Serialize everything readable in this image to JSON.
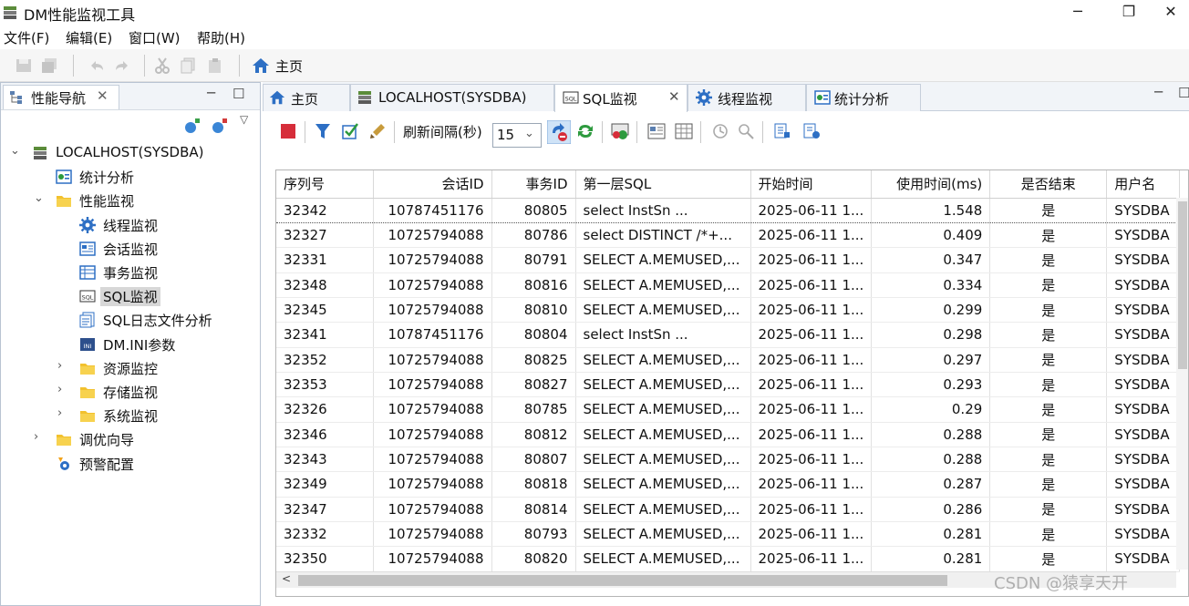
{
  "window": {
    "title": "DM性能监视工具",
    "controls": [
      "─",
      "❐",
      "✕"
    ]
  },
  "menu": [
    "文件(F)",
    "编辑(E)",
    "窗口(W)",
    "帮助(H)"
  ],
  "toolbar": {
    "home_label": "主页"
  },
  "nav": {
    "title": "性能导航",
    "tree": [
      {
        "label": "LOCALHOST(SYSDBA)",
        "icon": "server-icon",
        "level": 0,
        "expanded": true
      },
      {
        "label": "统计分析",
        "icon": "stats-icon",
        "level": 1
      },
      {
        "label": "性能监视",
        "icon": "folder-icon",
        "level": 1,
        "expanded": true
      },
      {
        "label": "线程监视",
        "icon": "gear-icon",
        "level": 2
      },
      {
        "label": "会话监视",
        "icon": "session-icon",
        "level": 2
      },
      {
        "label": "事务监视",
        "icon": "transaction-icon",
        "level": 2
      },
      {
        "label": "SQL监视",
        "icon": "sql-icon",
        "level": 2,
        "selected": true
      },
      {
        "label": "SQL日志文件分析",
        "icon": "log-icon",
        "level": 2
      },
      {
        "label": "DM.INI参数",
        "icon": "ini-icon",
        "level": 2
      },
      {
        "label": "资源监控",
        "icon": "folder-icon",
        "level": 2,
        "collapsed": true
      },
      {
        "label": "存储监视",
        "icon": "folder-icon",
        "level": 2,
        "collapsed": true
      },
      {
        "label": "系统监视",
        "icon": "folder-icon",
        "level": 2,
        "collapsed": true
      },
      {
        "label": "调优向导",
        "icon": "folder-icon",
        "level": 1,
        "collapsed": true
      },
      {
        "label": "预警配置",
        "icon": "alert-config-icon",
        "level": 1
      }
    ]
  },
  "tabs": [
    {
      "label": "主页",
      "icon": "home-icon"
    },
    {
      "label": "LOCALHOST(SYSDBA)",
      "icon": "server-icon"
    },
    {
      "label": "SQL监视",
      "icon": "sql-icon",
      "active": true,
      "closable": true
    },
    {
      "label": "线程监视",
      "icon": "gear-icon"
    },
    {
      "label": "统计分析",
      "icon": "stats-icon"
    }
  ],
  "sql_toolbar": {
    "interval_label": "刷新间隔(秒)",
    "interval_value": "15"
  },
  "table": {
    "columns": [
      "序列号",
      "会话ID",
      "事务ID",
      "第一层SQL",
      "开始时间",
      "使用时间(ms)",
      "是否结束",
      "用户名"
    ],
    "rows": [
      [
        "32342",
        "10787451176",
        "80805",
        "select            InstSn ...",
        "2025-06-11 1...",
        "1.548",
        "是",
        "SYSDBA"
      ],
      [
        "32327",
        "10725794088",
        "80786",
        "select DISTINCT  /*+...",
        "2025-06-11 1...",
        "0.409",
        "是",
        "SYSDBA"
      ],
      [
        "32331",
        "10725794088",
        "80791",
        "SELECT A.MEMUSED,...",
        "2025-06-11 1...",
        "0.347",
        "是",
        "SYSDBA"
      ],
      [
        "32348",
        "10725794088",
        "80816",
        "SELECT A.MEMUSED,...",
        "2025-06-11 1...",
        "0.334",
        "是",
        "SYSDBA"
      ],
      [
        "32345",
        "10725794088",
        "80810",
        "SELECT A.MEMUSED,...",
        "2025-06-11 1...",
        "0.299",
        "是",
        "SYSDBA"
      ],
      [
        "32341",
        "10787451176",
        "80804",
        "select            InstSn ...",
        "2025-06-11 1...",
        "0.298",
        "是",
        "SYSDBA"
      ],
      [
        "32352",
        "10725794088",
        "80825",
        "SELECT A.MEMUSED,...",
        "2025-06-11 1...",
        "0.297",
        "是",
        "SYSDBA"
      ],
      [
        "32353",
        "10725794088",
        "80827",
        "SELECT A.MEMUSED,...",
        "2025-06-11 1...",
        "0.293",
        "是",
        "SYSDBA"
      ],
      [
        "32326",
        "10725794088",
        "80785",
        "SELECT A.MEMUSED,...",
        "2025-06-11 1...",
        "0.29",
        "是",
        "SYSDBA"
      ],
      [
        "32346",
        "10725794088",
        "80812",
        "SELECT A.MEMUSED,...",
        "2025-06-11 1...",
        "0.288",
        "是",
        "SYSDBA"
      ],
      [
        "32343",
        "10725794088",
        "80807",
        "SELECT A.MEMUSED,...",
        "2025-06-11 1...",
        "0.288",
        "是",
        "SYSDBA"
      ],
      [
        "32349",
        "10725794088",
        "80818",
        "SELECT A.MEMUSED,...",
        "2025-06-11 1...",
        "0.287",
        "是",
        "SYSDBA"
      ],
      [
        "32347",
        "10725794088",
        "80814",
        "SELECT A.MEMUSED,...",
        "2025-06-11 1...",
        "0.286",
        "是",
        "SYSDBA"
      ],
      [
        "32332",
        "10725794088",
        "80793",
        "SELECT A.MEMUSED,...",
        "2025-06-11 1...",
        "0.281",
        "是",
        "SYSDBA"
      ],
      [
        "32350",
        "10725794088",
        "80820",
        "SELECT A.MEMUSED,...",
        "2025-06-11 1...",
        "0.281",
        "是",
        "SYSDBA"
      ]
    ]
  },
  "watermark": "CSDN @猿享天开",
  "colors": {
    "accent": "#2d6fc4",
    "selected": "#d7d7d7",
    "stop": "#d62d3a"
  }
}
